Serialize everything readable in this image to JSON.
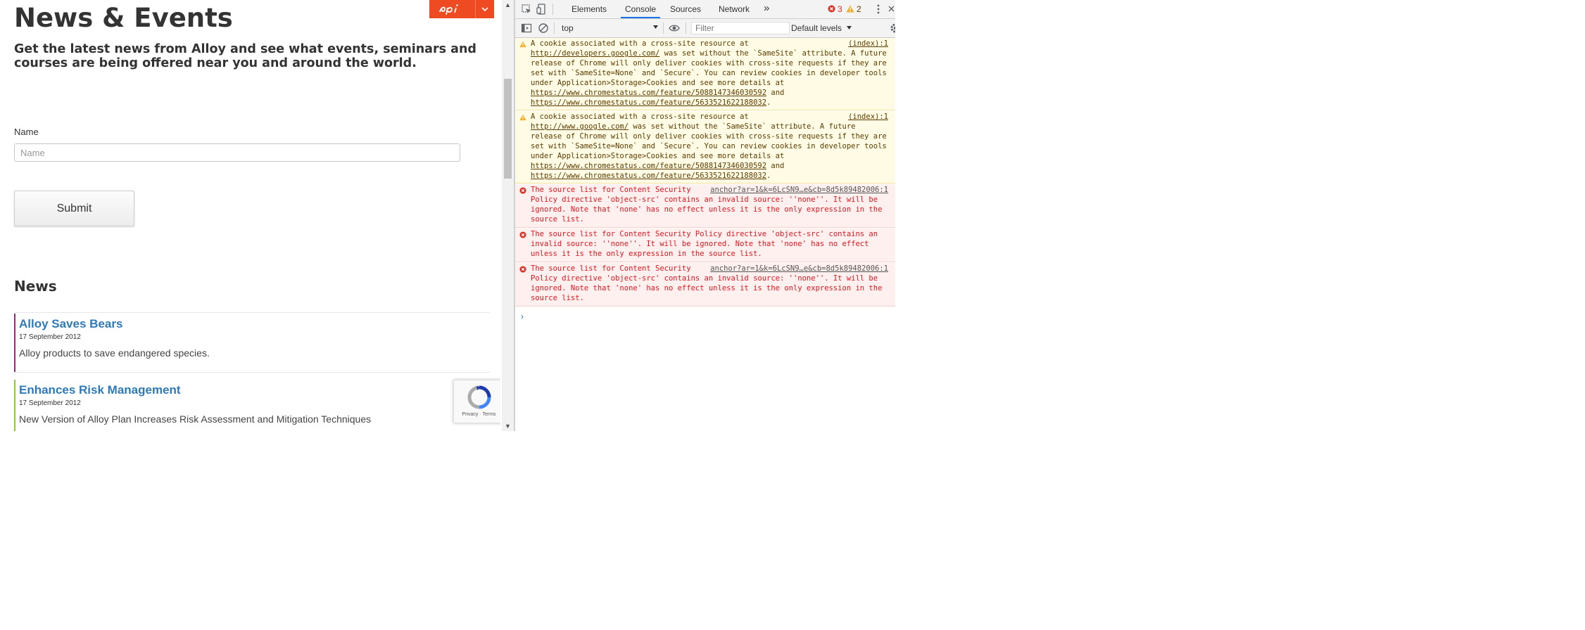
{
  "page": {
    "heading": "News & Events",
    "lead": "Get the latest news from Alloy and see what events, seminars and courses are being offered near you and around the world.",
    "form": {
      "name_label": "Name",
      "name_placeholder": "Name",
      "submit_label": "Submit"
    },
    "news_heading": "News",
    "news_items": [
      {
        "title": "Alloy Saves Bears",
        "date": "17 September 2012",
        "summary": "Alloy products to save endangered species.",
        "accent": "#8e2f7a"
      },
      {
        "title": "Enhances Risk Management",
        "date": "17 September 2012",
        "summary": "New Version of Alloy Plan Increases Risk Assessment and Mitigation Techniques",
        "accent": "#8dc63f"
      }
    ],
    "recaptcha": {
      "privacy": "Privacy",
      "separator": "·",
      "terms": "Terms"
    },
    "colors": {
      "epi_brand": "#ee4b22",
      "link": "#2e7ab8"
    }
  },
  "devtools": {
    "tabs": [
      "Elements",
      "Console",
      "Sources",
      "Network"
    ],
    "active_tab": "Console",
    "more_tabs": "»",
    "error_count": "3",
    "warning_count": "2",
    "context": "top",
    "filter_placeholder": "Filter",
    "levels": "Default levels",
    "messages": [
      {
        "level": "warning",
        "source": "(index):1",
        "lines": [
          {
            "t": "A cookie associated with a cross-site resource at "
          },
          {
            "t": "http://developers.google.com/",
            "link": true
          },
          {
            "t": " was set without the `SameSite` attribute. A future release of Chrome will only deliver cookies with cross-site requests if they are set with `SameSite=None` and `Secure`. You can review cookies in developer tools under Application>Storage>Cookies and see more details at "
          },
          {
            "t": "https://www.chromestatus.com/feature/5088147346030592",
            "link": true
          },
          {
            "t": " and "
          },
          {
            "t": "https://www.chromestatus.com/feature/5633521622188032",
            "link": true
          },
          {
            "t": "."
          }
        ]
      },
      {
        "level": "warning",
        "source": "(index):1",
        "lines": [
          {
            "t": "A cookie associated with a cross-site resource at "
          },
          {
            "t": "http://www.google.com/",
            "link": true
          },
          {
            "t": " was set without the `SameSite` attribute. A future release of Chrome will only deliver cookies with cross-site requests if they are set with `SameSite=None` and `Secure`. You can review cookies in developer tools under Application>Storage>Cookies and see more details at "
          },
          {
            "t": "https://www.chromestatus.com/feature/5088147346030592",
            "link": true
          },
          {
            "t": " and "
          },
          {
            "t": "https://www.chromestatus.com/feature/5633521622188032",
            "link": true
          },
          {
            "t": "."
          }
        ]
      },
      {
        "level": "error",
        "source": "anchor?ar=1&k=6LcSN9…e&cb=8d5k89482006:1",
        "lines": [
          {
            "t": "The source list for Content Security Policy directive 'object-src' contains an invalid source: ''none''. It will be ignored. Note that 'none' has no effect unless it is the only expression in the source list."
          }
        ]
      },
      {
        "level": "error",
        "source": "",
        "lines": [
          {
            "t": "The source list for Content Security Policy directive 'object-src' contains an invalid source: ''none''. It will be ignored. Note that 'none' has no effect unless it is the only expression in the source list."
          }
        ]
      },
      {
        "level": "error",
        "source": "anchor?ar=1&k=6LcSN9…e&cb=8d5k89482006:1",
        "lines": [
          {
            "t": "The source list for Content Security Policy directive 'object-src' contains an invalid source: ''none''. It will be ignored. Note that 'none' has no effect unless it is the only expression in the source list."
          }
        ]
      }
    ],
    "prompt": "›"
  }
}
